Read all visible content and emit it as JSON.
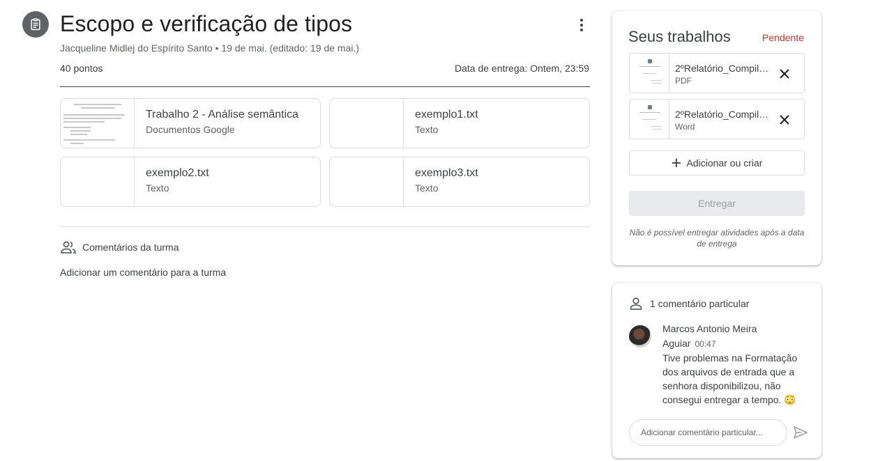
{
  "assignment": {
    "title": "Escopo e verificação de tipos",
    "meta": "Jacqueline Midlej do Espírito Santo • 19 de mai. (editado: 19 de mai.)",
    "points": "40 pontos",
    "due": "Data de entrega: Ontem, 23:59",
    "icon": "assignment-icon"
  },
  "attachments": [
    {
      "name": "Trabalho 2 - Análise semântica",
      "type": "Documentos Google"
    },
    {
      "name": "exemplo1.txt",
      "type": "Texto"
    },
    {
      "name": "exemplo2.txt",
      "type": "Texto"
    },
    {
      "name": "exemplo3.txt",
      "type": "Texto"
    }
  ],
  "class_comments": {
    "header": "Comentários da turma",
    "add_label": "Adicionar um comentário para a turma"
  },
  "your_work": {
    "title": "Seus trabalhos",
    "status": "Pendente",
    "files": [
      {
        "name": "2ºRelatório_Compiladores",
        "type": "PDF"
      },
      {
        "name": "2ºRelatório_Compiladores",
        "type": "Word"
      }
    ],
    "add_label": "Adicionar ou criar",
    "submit_label": "Entregar",
    "note": "Não é possível entregar atividades após a data de entrega"
  },
  "private_comments": {
    "header": "1 comentário particular",
    "author": "Marcos Antonio Meira Aguiar",
    "time": "00:47",
    "text": "Tive problemas na Formatação dos arquivos de entrada que a senhora disponibilizou, não consegui entregar a tempo. 😳",
    "input_placeholder": "Adicionar comentário particular..."
  },
  "colors": {
    "status": "#d93025",
    "icon_bg": "#5f6368",
    "border": "#dadce0"
  }
}
